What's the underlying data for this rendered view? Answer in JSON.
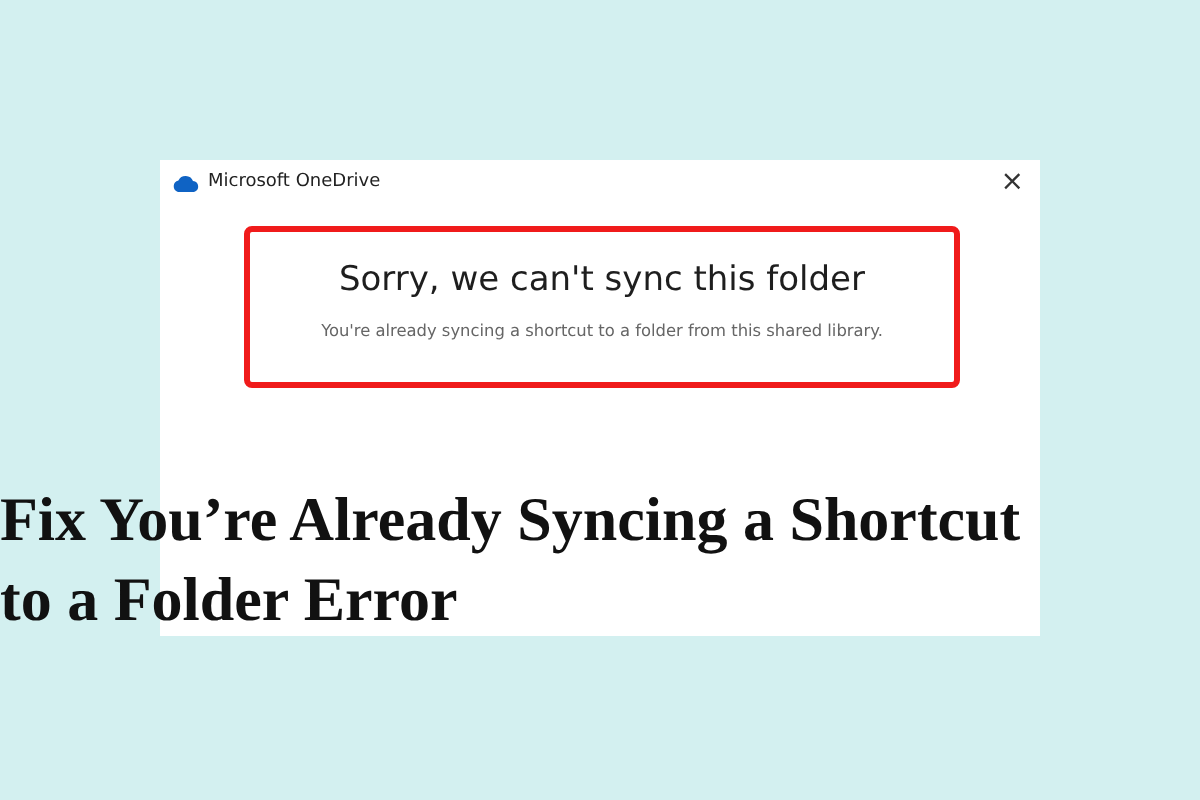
{
  "window": {
    "title": "Microsoft OneDrive",
    "close": "×"
  },
  "dialog": {
    "heading": "Sorry, we can't sync this folder",
    "message": "You're already syncing a shortcut to a folder from this shared library.",
    "highlighted": true
  },
  "headline": {
    "lines": [
      "Fix You’re Already Syncing a Shortcut",
      "to a Folder Error"
    ]
  }
}
